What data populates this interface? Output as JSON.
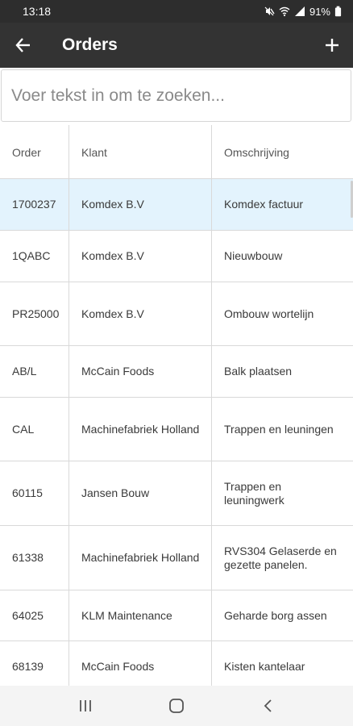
{
  "status_bar": {
    "time": "13:18",
    "battery": "91%",
    "icons": [
      "mute-icon",
      "wifi-icon",
      "signal-icon",
      "battery-icon"
    ]
  },
  "app_bar": {
    "title": "Orders",
    "back_icon": "arrow-left-icon",
    "add_icon": "plus-icon"
  },
  "search": {
    "placeholder": "Voer tekst in om te zoeken...",
    "value": ""
  },
  "table": {
    "columns": [
      "Order",
      "Klant",
      "Omschrijving"
    ],
    "rows": [
      {
        "order": "1700237",
        "klant": "Komdex B.V",
        "omschrijving": "Komdex factuur",
        "selected": true
      },
      {
        "order": "1QABC",
        "klant": "Komdex B.V",
        "omschrijving": "Nieuwbouw"
      },
      {
        "order": "PR25000",
        "klant": "Komdex B.V",
        "omschrijving": "Ombouw wortelijn"
      },
      {
        "order": "AB/L",
        "klant": "McCain Foods",
        "omschrijving": "Balk plaatsen"
      },
      {
        "order": "CAL",
        "klant": "Machinefabriek Holland",
        "omschrijving": "Trappen en leuningen"
      },
      {
        "order": "60115",
        "klant": "Jansen Bouw",
        "omschrijving": "Trappen en leuningwerk"
      },
      {
        "order": "61338",
        "klant": "Machinefabriek Holland",
        "omschrijving": "RVS304 Gelaserde en gezette panelen."
      },
      {
        "order": "64025",
        "klant": "KLM Maintenance",
        "omschrijving": "Geharde borg assen"
      },
      {
        "order": "68139",
        "klant": "McCain Foods",
        "omschrijving": "Kisten kantelaar"
      }
    ]
  },
  "nav_bar": {
    "icons": [
      "recents-icon",
      "home-icon",
      "back-icon"
    ]
  },
  "colors": {
    "app_bar": "#333333",
    "status_bar": "#2d2d2d",
    "selected_row": "#e3f3fd",
    "divider": "#d9d9d9"
  }
}
